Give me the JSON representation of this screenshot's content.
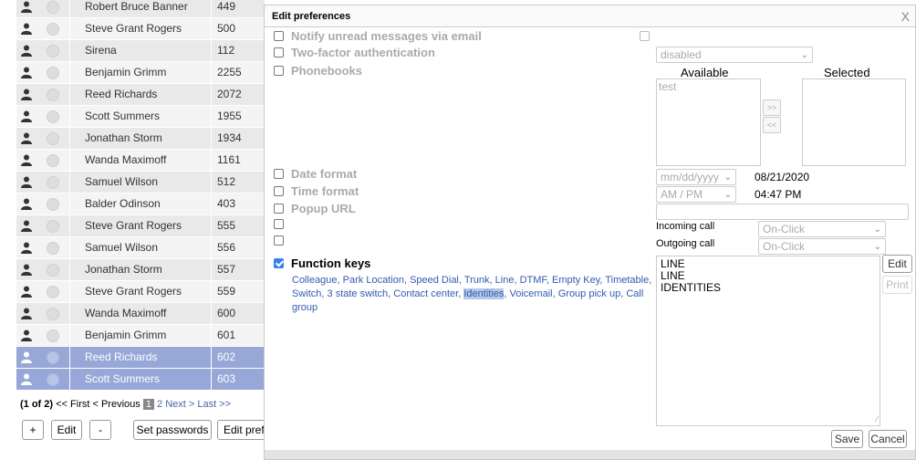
{
  "users": [
    {
      "name": "Robert Bruce Banner",
      "num": "449"
    },
    {
      "name": "Steve Grant Rogers",
      "num": "500"
    },
    {
      "name": "Sirena",
      "num": "112"
    },
    {
      "name": "Benjamin Grimm",
      "num": "2255"
    },
    {
      "name": "Reed Richards",
      "num": "2072"
    },
    {
      "name": "Scott Summers",
      "num": "1955"
    },
    {
      "name": "Jonathan Storm",
      "num": "1934"
    },
    {
      "name": "Wanda Maximoff",
      "num": "1161"
    },
    {
      "name": "Samuel Wilson",
      "num": "512"
    },
    {
      "name": "Balder Odinson",
      "num": "403"
    },
    {
      "name": "Steve Grant Rogers",
      "num": "555"
    },
    {
      "name": "Samuel Wilson",
      "num": "556"
    },
    {
      "name": "Jonathan Storm",
      "num": "557"
    },
    {
      "name": "Steve Grant Rogers",
      "num": "559"
    },
    {
      "name": "Wanda Maximoff",
      "num": "600"
    },
    {
      "name": "Benjamin Grimm",
      "num": "601"
    },
    {
      "name": "Reed Richards",
      "num": "602"
    },
    {
      "name": "Scott Summers",
      "num": "603"
    }
  ],
  "pager": {
    "count": "(1 of 2)",
    "first": "<< First",
    "prev": "< Previous",
    "current": "1",
    "page2": "2",
    "next": "Next >",
    "last": "Last >>"
  },
  "buttons": {
    "add": "+",
    "edit": "Edit",
    "remove": "-",
    "set_passwords": "Set passwords",
    "edit_prefs": "Edit prefe"
  },
  "dialog": {
    "title": "Edit preferences",
    "close": "X",
    "notify": "Notify unread messages via email",
    "two_factor": "Two-factor authentication",
    "two_factor_value": "disabled",
    "phonebooks": "Phonebooks",
    "available": "Available",
    "selected": "Selected",
    "available_items": [
      "test"
    ],
    "move_right": ">>",
    "move_left": "<<",
    "date_format": "Date format",
    "date_format_value": "mm/dd/yyyy",
    "date_preview": "08/21/2020",
    "time_format": "Time format",
    "time_format_value": "AM / PM",
    "time_preview": "04:47 PM",
    "popup_url": "Popup URL",
    "incoming_call": "Incoming call",
    "incoming_value": "On-Click",
    "outgoing_call": "Outgoing call",
    "outgoing_value": "On-Click",
    "function_keys": "Function keys",
    "fk_links": [
      "Colleague",
      "Park Location",
      "Speed Dial",
      "Trunk",
      "Line",
      "DTMF",
      "Empty Key",
      "Timetable",
      "Switch",
      "3 state switch",
      "Contact center",
      "Identities",
      "Voicemail",
      "Group pick up",
      "Call group"
    ],
    "fk_items": [
      "LINE",
      "LINE",
      "IDENTITIES"
    ],
    "edit": "Edit",
    "print": "Print",
    "save": "Save",
    "cancel": "Cancel"
  },
  "colors": {
    "selected_row": "#97a8d8",
    "link": "#335bb0",
    "checkbox": "#3a7ef0"
  }
}
